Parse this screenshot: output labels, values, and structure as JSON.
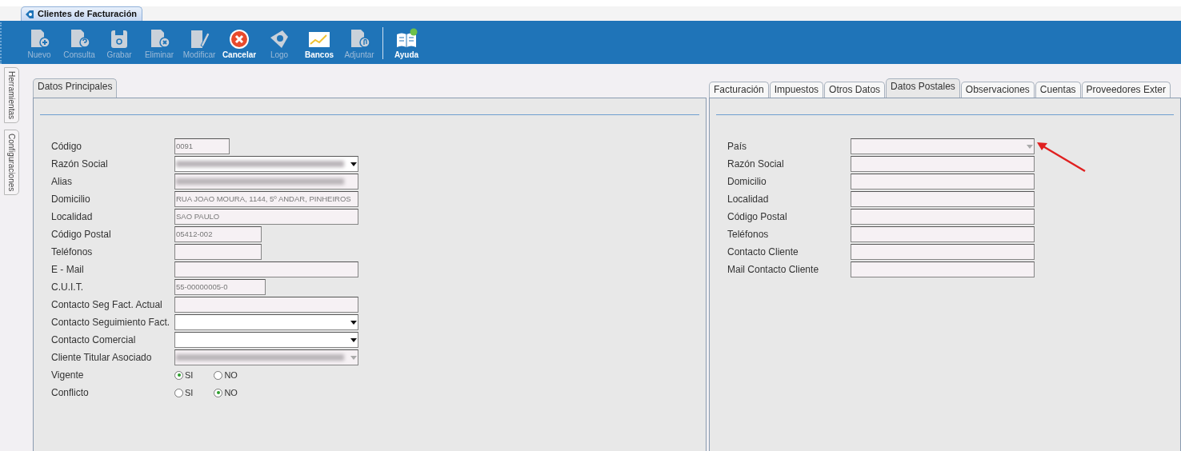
{
  "window_tab": {
    "title": "Clientes de Facturación"
  },
  "toolbar": [
    {
      "label": "Nuevo",
      "kind": "new",
      "disabled": true
    },
    {
      "label": "Consulta",
      "kind": "query",
      "disabled": true
    },
    {
      "label": "Grabar",
      "kind": "save",
      "disabled": true
    },
    {
      "label": "Eliminar",
      "kind": "delete",
      "disabled": true
    },
    {
      "label": "Modificar",
      "kind": "edit",
      "disabled": true
    },
    {
      "label": "Cancelar",
      "kind": "cancel",
      "disabled": false
    },
    {
      "label": "Logo",
      "kind": "logo",
      "disabled": true
    },
    {
      "label": "Bancos",
      "kind": "chart",
      "disabled": false
    },
    {
      "label": "Adjuntar",
      "kind": "attach",
      "disabled": true
    },
    {
      "label": "Ayuda",
      "kind": "help",
      "disabled": false
    }
  ],
  "side_tabs": [
    {
      "label": "Herramientas"
    },
    {
      "label": "Configuraciones"
    }
  ],
  "left_panel": {
    "tabs": [
      {
        "label": "Datos Principales",
        "selected": true
      }
    ],
    "fields": [
      {
        "label": "Código",
        "kind": "text",
        "value": "0091",
        "readonly": true
      },
      {
        "label": "Razón Social",
        "kind": "select",
        "redacted": true,
        "readonly": false
      },
      {
        "label": "Alias",
        "kind": "text",
        "redacted": true,
        "readonly": true
      },
      {
        "label": "Domicilio",
        "kind": "text",
        "value": "RUA JOAO MOURA, 1144, 5º ANDAR, PINHEIROS",
        "readonly": true
      },
      {
        "label": "Localidad",
        "kind": "text",
        "value": "SAO PAULO",
        "readonly": true
      },
      {
        "label": "Código Postal",
        "kind": "text",
        "value": "05412-002",
        "readonly": true
      },
      {
        "label": "Teléfonos",
        "kind": "text",
        "readonly": true
      },
      {
        "label": "E - Mail",
        "kind": "text",
        "readonly": true
      },
      {
        "label": "C.U.I.T.",
        "kind": "text",
        "value": "55-00000005-0",
        "readonly": true
      },
      {
        "label": "Contacto Seg Fact. Actual",
        "kind": "text",
        "readonly": true
      },
      {
        "label": "Contacto Seguimiento Fact.",
        "kind": "select",
        "readonly": false
      },
      {
        "label": "Contacto Comercial",
        "kind": "select",
        "readonly": false
      },
      {
        "label": "Cliente Titular Asociado",
        "kind": "select",
        "redacted": true,
        "readonly": true
      },
      {
        "label": "Vigente",
        "kind": "radio",
        "options": [
          {
            "label": "SI",
            "selected": true
          },
          {
            "label": "NO",
            "selected": false
          }
        ]
      },
      {
        "label": "Conflicto",
        "kind": "radio",
        "options": [
          {
            "label": "SI",
            "selected": false
          },
          {
            "label": "NO",
            "selected": true
          }
        ]
      }
    ]
  },
  "right_panel": {
    "tabs": [
      {
        "label": "Facturación",
        "selected": false
      },
      {
        "label": "Impuestos",
        "selected": false
      },
      {
        "label": "Otros Datos",
        "selected": false
      },
      {
        "label": "Datos Postales",
        "selected": true
      },
      {
        "label": "Observaciones",
        "selected": false
      },
      {
        "label": "Cuentas",
        "selected": false
      },
      {
        "label": "Proveedores Exter",
        "selected": false
      }
    ],
    "fields": [
      {
        "label": "País",
        "kind": "select",
        "readonly": true,
        "annotated": true
      },
      {
        "label": "Razón Social",
        "kind": "text",
        "readonly": true
      },
      {
        "label": "Domicilio",
        "kind": "text",
        "readonly": true
      },
      {
        "label": "Localidad",
        "kind": "text",
        "readonly": true
      },
      {
        "label": "Código Postal",
        "kind": "text",
        "readonly": true
      },
      {
        "label": "Teléfonos",
        "kind": "text",
        "readonly": true
      },
      {
        "label": "Contacto Cliente",
        "kind": "text",
        "readonly": true
      },
      {
        "label": "Mail Contacto Cliente",
        "kind": "text",
        "readonly": true
      }
    ]
  }
}
